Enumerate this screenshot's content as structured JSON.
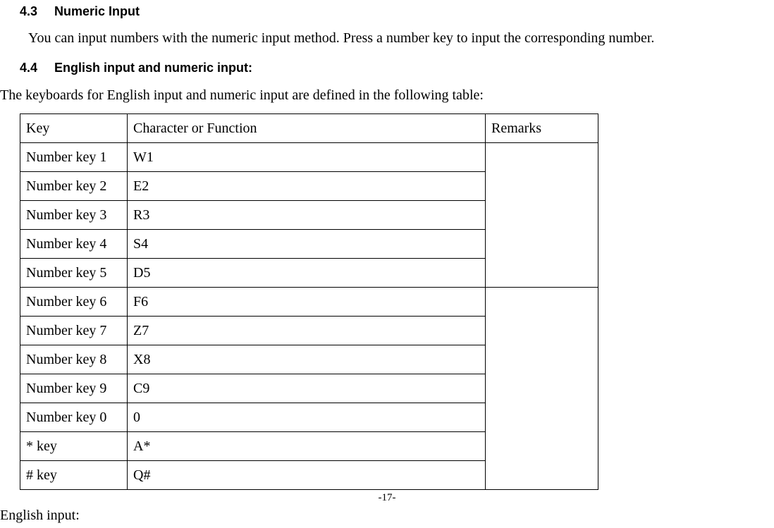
{
  "section43": {
    "num": "4.3",
    "title": "Numeric Input",
    "text": "You can input numbers with the numeric input method. Press a number key to input the corresponding number."
  },
  "section44": {
    "num": "4.4",
    "title": "English input and numeric input:",
    "intro": "The keyboards for English input and numeric input are defined in the following table:"
  },
  "table": {
    "headers": [
      "Key",
      "Character or Function",
      "Remarks"
    ],
    "rows": [
      {
        "key": "Number key 1",
        "char": "W1"
      },
      {
        "key": "Number key 2",
        "char": "E2"
      },
      {
        "key": "Number key 3",
        "char": "R3"
      },
      {
        "key": "Number key 4",
        "char": "S4"
      },
      {
        "key": "Number key 5",
        "char": "D5"
      },
      {
        "key": "Number key 6",
        "char": "F6"
      },
      {
        "key": "Number key 7",
        "char": "Z7"
      },
      {
        "key": "Number key 8",
        "char": "X8"
      },
      {
        "key": "Number key 9",
        "char": "C9"
      },
      {
        "key": "Number key 0",
        "char": "0"
      },
      {
        "key": "* key",
        "char": "A*"
      },
      {
        "key": "# key",
        "char": "Q#"
      }
    ]
  },
  "english_input_label": "English input:",
  "page_number": "-17-"
}
